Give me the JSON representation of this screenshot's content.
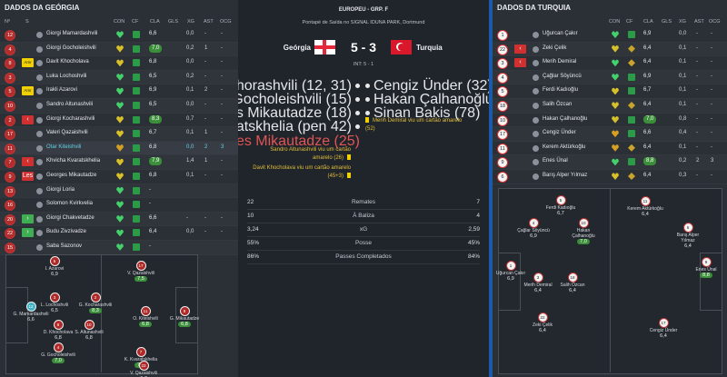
{
  "left": {
    "title": "DADOS DA GEÓRGIA",
    "headers": {
      "num": "Nº",
      "s": "S",
      "con": "CON",
      "cf": "CF",
      "cla": "CLA",
      "gls": "GLS",
      "xg": "XG",
      "ast": "AST",
      "ocg": "OCG"
    },
    "rows": [
      {
        "num": "12",
        "stat": "",
        "name": "Giorgi Mamardashvili",
        "con": "green",
        "cf": "green",
        "cla": "6,6",
        "gls": "",
        "xg": "0,0",
        "ast": "-",
        "ocg": "-"
      },
      {
        "num": "4",
        "stat": "",
        "name": "Giorgi Gocholeishvili",
        "con": "yellow",
        "cf": "green",
        "cla": "7,0",
        "cla_badge": true,
        "gls": "",
        "xg": "0,2",
        "ast": "1",
        "ocg": "-"
      },
      {
        "num": "8",
        "stat": "Amr",
        "name": "Davit Khocholava",
        "con": "yellow",
        "cf": "green",
        "cla": "6,8",
        "gls": "",
        "xg": "0,0",
        "ast": "-",
        "ocg": "-"
      },
      {
        "num": "3",
        "stat": "",
        "name": "Luka Lochoshvili",
        "con": "green",
        "cf": "green",
        "cla": "6,5",
        "gls": "",
        "xg": "0,2",
        "ast": "-",
        "ocg": "-"
      },
      {
        "num": "5",
        "stat": "Amr",
        "name": "Irakli Azarovi",
        "con": "green",
        "cf": "green",
        "cla": "6,9",
        "gls": "",
        "xg": "0,1",
        "ast": "2",
        "ocg": "-"
      },
      {
        "num": "10",
        "stat": "",
        "name": "Sandro Altunashvili",
        "con": "green",
        "cf": "green",
        "cla": "6,5",
        "gls": "",
        "xg": "0,0",
        "ast": "-",
        "ocg": "-"
      },
      {
        "num": "2",
        "stat": "out",
        "name": "Giorgi Kocharashvili",
        "con": "yellow",
        "cf": "green",
        "cla": "8,3",
        "cla_badge": true,
        "gls": "",
        "xg": "0,7",
        "ast": "-",
        "ocg": "-"
      },
      {
        "num": "17",
        "stat": "",
        "name": "Valeri Qazaishvili",
        "con": "yellow",
        "cf": "green",
        "cla": "6,7",
        "gls": "",
        "xg": "0,1",
        "ast": "1",
        "ocg": "-"
      },
      {
        "num": "11",
        "stat": "",
        "name": "Otar Kiteishvili",
        "con": "orange",
        "cf": "green",
        "cla": "6,8",
        "gls": "",
        "xg": "0,0",
        "ast": "2",
        "ocg": "3",
        "highlight": true
      },
      {
        "num": "7",
        "stat": "out",
        "name": "Khvicha Kvaratskhelia",
        "con": "yellow",
        "cf": "green",
        "cla": "7,9",
        "cla_badge": true,
        "gls": "",
        "xg": "1,4",
        "ast": "1",
        "ocg": "-"
      },
      {
        "num": "9",
        "stat": "Les",
        "name": "Georges Mikautadze",
        "con": "yellow",
        "cf": "green",
        "cla": "6,8",
        "gls": "",
        "xg": "0,1",
        "ast": "-",
        "ocg": "-"
      },
      {
        "num": "13",
        "stat": "",
        "name": "Giorgi Loria",
        "con": "green",
        "cf": "green",
        "cla": "-",
        "gls": "",
        "xg": "",
        "ast": "",
        "ocg": ""
      },
      {
        "num": "16",
        "stat": "",
        "name": "Solomon Kvirkvelia",
        "con": "green",
        "cf": "green",
        "cla": "-",
        "gls": "",
        "xg": "",
        "ast": "",
        "ocg": ""
      },
      {
        "num": "20",
        "stat": "in",
        "name": "Giorgi Chakvetadze",
        "con": "green",
        "cf": "green",
        "cla": "6,6",
        "gls": "",
        "xg": "-",
        "ast": "-",
        "ocg": "-"
      },
      {
        "num": "22",
        "stat": "in",
        "name": "Budu Zivzivadze",
        "con": "green",
        "cf": "green",
        "cla": "6,4",
        "gls": "",
        "xg": "0,0",
        "ast": "-",
        "ocg": "-"
      },
      {
        "num": "15",
        "stat": "",
        "name": "Saba Sazonov",
        "con": "green",
        "cf": "green",
        "cla": "-",
        "gls": "",
        "xg": "",
        "ast": "",
        "ocg": ""
      }
    ],
    "pitch_players": [
      {
        "num": "5",
        "name": "I. Azarovi",
        "rating": "6,9"
      },
      {
        "num": "17",
        "name": "V. Qazaishvili",
        "rating": "7,5",
        "badge": true
      },
      {
        "num": "3",
        "name": "L. Lochoshvili",
        "rating": "6,5"
      },
      {
        "num": "2",
        "name": "G. Kocharashvili",
        "rating": "8,3",
        "badge": true
      },
      {
        "num": "12",
        "name": "G. Mamardashvili",
        "rating": "6,6",
        "gk": true
      },
      {
        "num": "8",
        "name": "D. Khocholava",
        "rating": "6,8"
      },
      {
        "num": "10",
        "name": "S. Altunashvili",
        "rating": "6,8"
      },
      {
        "num": "11",
        "name": "O. Kiteishvili",
        "rating": "6,8",
        "badge": true
      },
      {
        "num": "9",
        "name": "G. Mikautadze",
        "rating": "6,8",
        "badge": true
      },
      {
        "num": "4",
        "name": "G. Gocholeishvili",
        "rating": "7,0",
        "badge": true
      },
      {
        "num": "7",
        "name": "K. Kvaratskhelia",
        "rating": "7,9",
        "badge": true
      },
      {
        "num": "22",
        "name": "V. Qazaishvili",
        "rating": "6,7"
      }
    ]
  },
  "match": {
    "competition": "EUROPEU - GRP. F",
    "venue": "Pontapé de Saída no SIGNAL IDUNA PARK, Dortmund",
    "home": "Geórgia",
    "away": "Turquia",
    "score": "5 - 3",
    "interval": "INT: 5 - 1",
    "home_flag_color": "#e5293b",
    "away_flag_color": "#d9182b",
    "home_events": [
      {
        "text": "Giorgi Kochorashvili (12, 31)",
        "type": "goal"
      },
      {
        "text": "Giorgi Gocholeishvili (15)",
        "type": "goal"
      },
      {
        "text": "Georges Mikautadze (18)",
        "type": "goal"
      },
      {
        "text": "Khvicha Kvaratskhelia (pen 42)",
        "type": "goal"
      },
      {
        "text": "Lesão de Georges Mikautadze (25)",
        "type": "injury"
      },
      {
        "text": "Sandro Altunashvili viu um cartão amarelo (26)",
        "type": "yellow"
      },
      {
        "text": "Davit Khocholava viu um cartão amarelo (45+3)",
        "type": "yellow"
      }
    ],
    "away_events": [
      {
        "text": "Cengiz Ünder (32)",
        "type": "goal"
      },
      {
        "text": "Hakan Çalhanoğlu (pen 66)",
        "type": "goal"
      },
      {
        "text": "Sinan Bakis (78)",
        "type": "goal"
      },
      {
        "text": "Merih Demiral viu um cartão amarelo (52)",
        "type": "yellow"
      }
    ],
    "stats": [
      {
        "home": "22",
        "label": "Remates",
        "away": "7"
      },
      {
        "home": "10",
        "label": "À Baliza",
        "away": "4"
      },
      {
        "home": "3,24",
        "label": "xG",
        "away": "2,59"
      },
      {
        "home": "55%",
        "label": "Posse",
        "away": "45%"
      },
      {
        "home": "86%",
        "label": "Passes Completados",
        "away": "84%"
      }
    ]
  },
  "right": {
    "title": "DADOS DA TURQUIA",
    "headers": {
      "con": "CON",
      "cf": "CF",
      "cla": "CLA",
      "gls": "GLS",
      "xg": "XG",
      "ast": "AST",
      "ocg": "OCG"
    },
    "rows": [
      {
        "num": "1",
        "stat": "",
        "name": "Uğurcan Çakır",
        "con": "green",
        "cf": "green",
        "cla": "6,9",
        "xg": "0,0",
        "ast": "-",
        "ocg": "-"
      },
      {
        "num": "22",
        "stat": "out",
        "name": "Zeki Çelik",
        "con": "yellow",
        "cf": "yellow",
        "cla": "6,4",
        "xg": "0,1",
        "ast": "-",
        "ocg": "-"
      },
      {
        "num": "3",
        "stat": "out",
        "name": "Merih Demiral",
        "con": "green",
        "cf": "yellow",
        "cla": "6,4",
        "xg": "0,1",
        "ast": "-",
        "ocg": "-"
      },
      {
        "num": "4",
        "stat": "",
        "name": "Çağlar Söyüncü",
        "con": "green",
        "cf": "green",
        "cla": "6,9",
        "xg": "0,1",
        "ast": "-",
        "ocg": "-"
      },
      {
        "num": "5",
        "stat": "",
        "name": "Ferdi Kadıoğlu",
        "con": "yellow",
        "cf": "green",
        "cla": "6,7",
        "xg": "0,1",
        "ast": "-",
        "ocg": "-"
      },
      {
        "num": "18",
        "stat": "",
        "name": "Salih Özcan",
        "con": "yellow",
        "cf": "yellow",
        "cla": "6,4",
        "xg": "0,1",
        "ast": "-",
        "ocg": "-"
      },
      {
        "num": "10",
        "stat": "",
        "name": "Hakan Çalhanoğlu",
        "con": "yellow",
        "cf": "green",
        "cla": "7,0",
        "cla_badge": true,
        "xg": "0,8",
        "ast": "-",
        "ocg": "-"
      },
      {
        "num": "17",
        "stat": "",
        "name": "Cengiz Ünder",
        "con": "orange",
        "cf": "green",
        "cla": "6,6",
        "xg": "0,4",
        "ast": "-",
        "ocg": "-"
      },
      {
        "num": "11",
        "stat": "",
        "name": "Kerem Aktürkoğlu",
        "con": "orange",
        "cf": "yellow",
        "cla": "6,4",
        "xg": "0,1",
        "ast": "-",
        "ocg": "-"
      },
      {
        "num": "9",
        "stat": "",
        "name": "Enes Ünal",
        "con": "green",
        "cf": "green",
        "cla": "8,8",
        "cla_badge": true,
        "xg": "0,2",
        "ast": "2",
        "ocg": "3"
      },
      {
        "num": "6",
        "stat": "",
        "name": "Barış Alper Yılmaz",
        "con": "yellow",
        "cf": "yellow",
        "cla": "6,4",
        "xg": "0,3",
        "ast": "-",
        "ocg": "-"
      }
    ],
    "pitch_players": [
      {
        "num": "5",
        "name": "Ferdi Kadıoğlu",
        "rating": "6,7"
      },
      {
        "num": "11",
        "name": "Kerem Aktürkoğlu",
        "rating": "6,4"
      },
      {
        "num": "4",
        "name": "Çağlar Söyüncü",
        "rating": "6,9"
      },
      {
        "num": "10",
        "name": "Hakan Çalhanoğlu",
        "rating": "7,0",
        "badge": true
      },
      {
        "num": "6",
        "name": "Barış Alper Yılmaz",
        "rating": "6,4"
      },
      {
        "num": "1",
        "name": "Uğurcan Çakır",
        "rating": "6,9"
      },
      {
        "num": "3",
        "name": "Merih Demiral",
        "rating": "6,4"
      },
      {
        "num": "18",
        "name": "Salih Özcan",
        "rating": "6,4"
      },
      {
        "num": "9",
        "name": "Enes Ünal",
        "rating": "8,8",
        "badge": true
      },
      {
        "num": "22",
        "name": "Zeki Çelik",
        "rating": "6,4"
      },
      {
        "num": "17",
        "name": "Cengiz Ünder",
        "rating": "6,4"
      }
    ]
  }
}
